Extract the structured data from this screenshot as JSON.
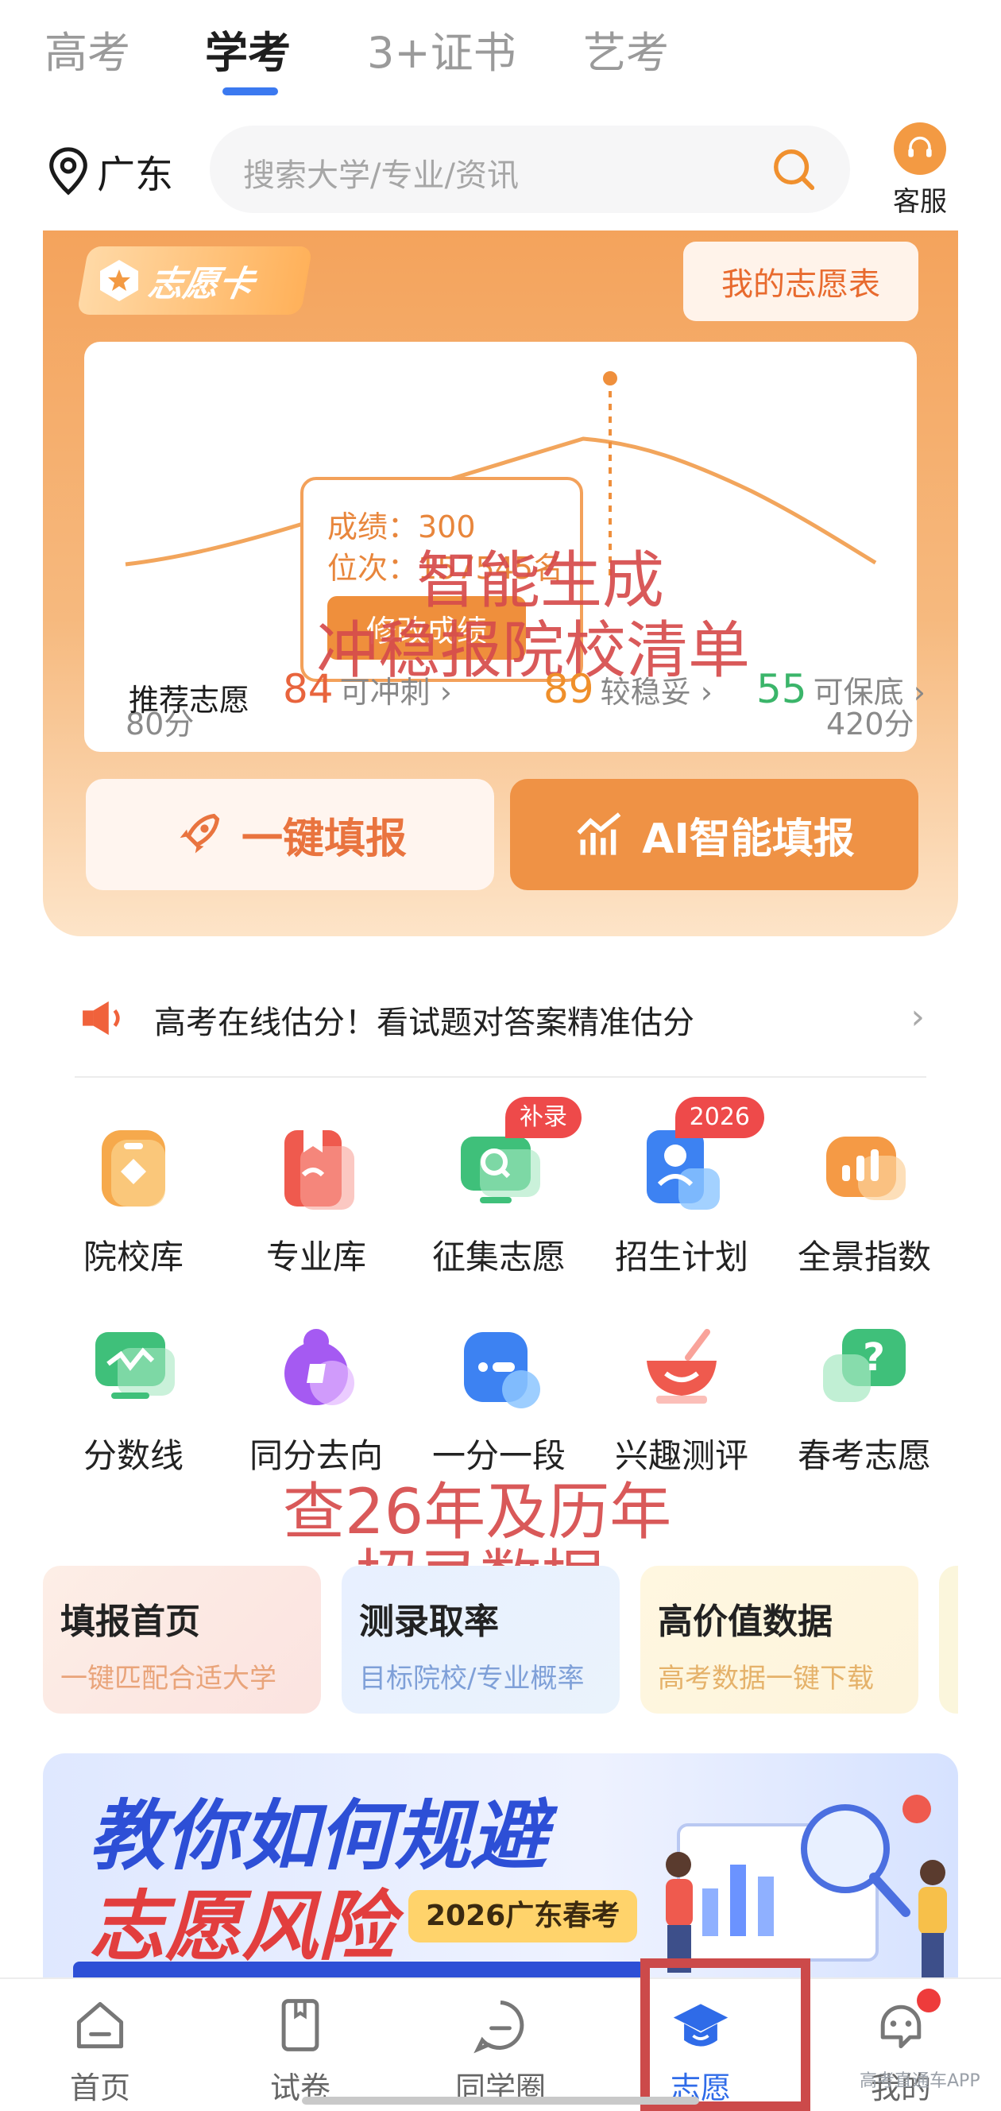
{
  "top_tabs": [
    "高考",
    "学考",
    "3+证书",
    "艺考"
  ],
  "location": "广东",
  "search": {
    "placeholder": "搜索大学/专业/资讯"
  },
  "service_label": "客服",
  "volunteer_card": {
    "badge": "志愿卡",
    "my_table_button": "我的志愿表",
    "chart": {
      "min_label": "80分",
      "max_label": "420分",
      "tooltip_score": "成绩：300",
      "tooltip_rank": "位次：157545名",
      "tooltip_button": "修改成绩"
    },
    "overlay_text_line1": "智能生成",
    "overlay_text_line2": "冲稳报院校清单",
    "recommend_label": "推荐志愿",
    "recommend": [
      {
        "count": "84",
        "label": "可冲刺",
        "color": "#e8643d"
      },
      {
        "count": "89",
        "label": "较稳妥",
        "color": "#ef8f2a"
      },
      {
        "count": "55",
        "label": "可保底",
        "color": "#3bb56a"
      }
    ],
    "one_click_button": "一键填报",
    "ai_button": "AI智能填报"
  },
  "notice": "高考在线估分！看试题对答案精准估分",
  "grid": [
    {
      "label": "院校库",
      "icon": "school-icon"
    },
    {
      "label": "专业库",
      "icon": "major-book-icon"
    },
    {
      "label": "征集志愿",
      "icon": "collect-search-icon",
      "tag": "补录"
    },
    {
      "label": "招生计划",
      "icon": "enroll-plan-icon",
      "tag": "2026"
    },
    {
      "label": "全景指数",
      "icon": "panorama-bars-icon"
    },
    {
      "label": "分数线",
      "icon": "score-line-icon"
    },
    {
      "label": "同分去向",
      "icon": "same-score-icon"
    },
    {
      "label": "一分一段",
      "icon": "score-segment-icon"
    },
    {
      "label": "兴趣测评",
      "icon": "interest-test-icon"
    },
    {
      "label": "春考志愿",
      "icon": "spring-exam-icon"
    }
  ],
  "overlay_grid_line1": "查26年及历年",
  "overlay_grid_line2": "招录数据",
  "feature_cards": [
    {
      "title": "填报首页",
      "sub": "一键匹配合适大学",
      "sub_color": "#e9a47a"
    },
    {
      "title": "测录取率",
      "sub": "目标院校/专业概率",
      "sub_color": "#7fa0d8"
    },
    {
      "title": "高价值数据",
      "sub": "高考数据一键下载",
      "sub_color": "#e5b26a"
    }
  ],
  "banner": {
    "line1": "教你如何规避",
    "line2": "志愿风险",
    "tag": "2026广东春考"
  },
  "bottom_nav": [
    "首页",
    "试卷",
    "同学圈",
    "志愿",
    "我的"
  ],
  "watermark": "高考直通车APP"
}
